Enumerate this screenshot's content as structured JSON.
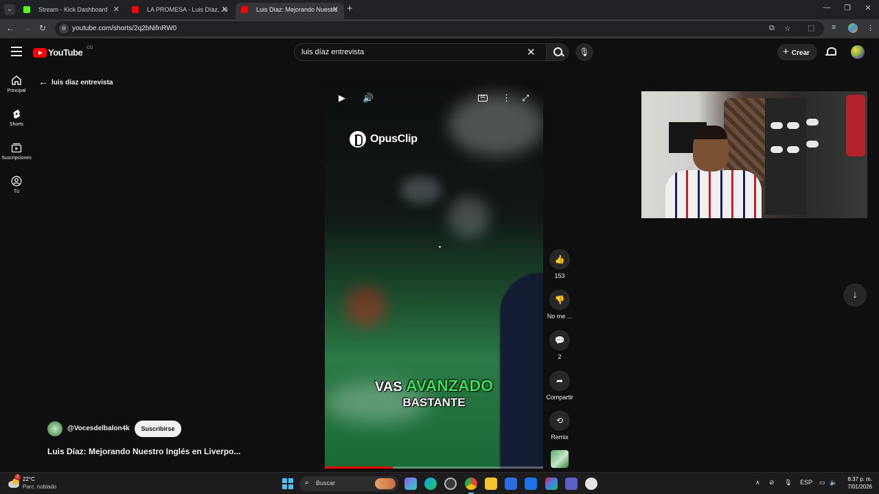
{
  "browser": {
    "tabs": [
      {
        "title": "Stream - Kick Dashboard",
        "favicon_color": "#53fc18",
        "active": false
      },
      {
        "title": "LA PROMESA - Luis Díaz, Juanc",
        "favicon_color": "#ff0000",
        "active": false
      },
      {
        "title": "Luis Díaz: Mejorando Nuestro I",
        "favicon_color": "#ff0000",
        "active": true
      }
    ],
    "url": "youtube.com/shorts/2q2bNifnRW0"
  },
  "youtube": {
    "logo_text": "YouTube",
    "country_code": "CO",
    "search_query": "luis díaz entrevista",
    "create_label": "Crear",
    "rail": [
      {
        "label": "Principal",
        "icon": "home-icon"
      },
      {
        "label": "Shorts",
        "icon": "shorts-icon"
      },
      {
        "label": "Suscripciones",
        "icon": "subscriptions-icon"
      },
      {
        "label": "Tú",
        "icon": "you-icon"
      }
    ],
    "back_label": "luis díaz entrevista"
  },
  "short": {
    "watermark": "OpusClip",
    "caption_line1_plain": "VAS",
    "caption_line1_highlight": "AVANZADO",
    "caption_line2": "BASTANTE",
    "highlight_color": "#39e15a",
    "progress": 0.31
  },
  "actions": {
    "like_count": "153",
    "dislike_label": "No me ...",
    "comments_count": "2",
    "share_label": "Compartir",
    "remix_label": "Remix"
  },
  "channel": {
    "handle": "@Vocesdelbalon4k",
    "subscribe_label": "Suscribirse",
    "video_title": "Luis Díaz: Mejorando Nuestro Inglés en Liverpo..."
  },
  "taskbar": {
    "weather_badge": "2",
    "temperature": "22°C",
    "condition": "Parc. nublado",
    "search_placeholder": "Buscar",
    "language": "ESP",
    "time": "8:37 p. m.",
    "date": "7/01/2026"
  }
}
